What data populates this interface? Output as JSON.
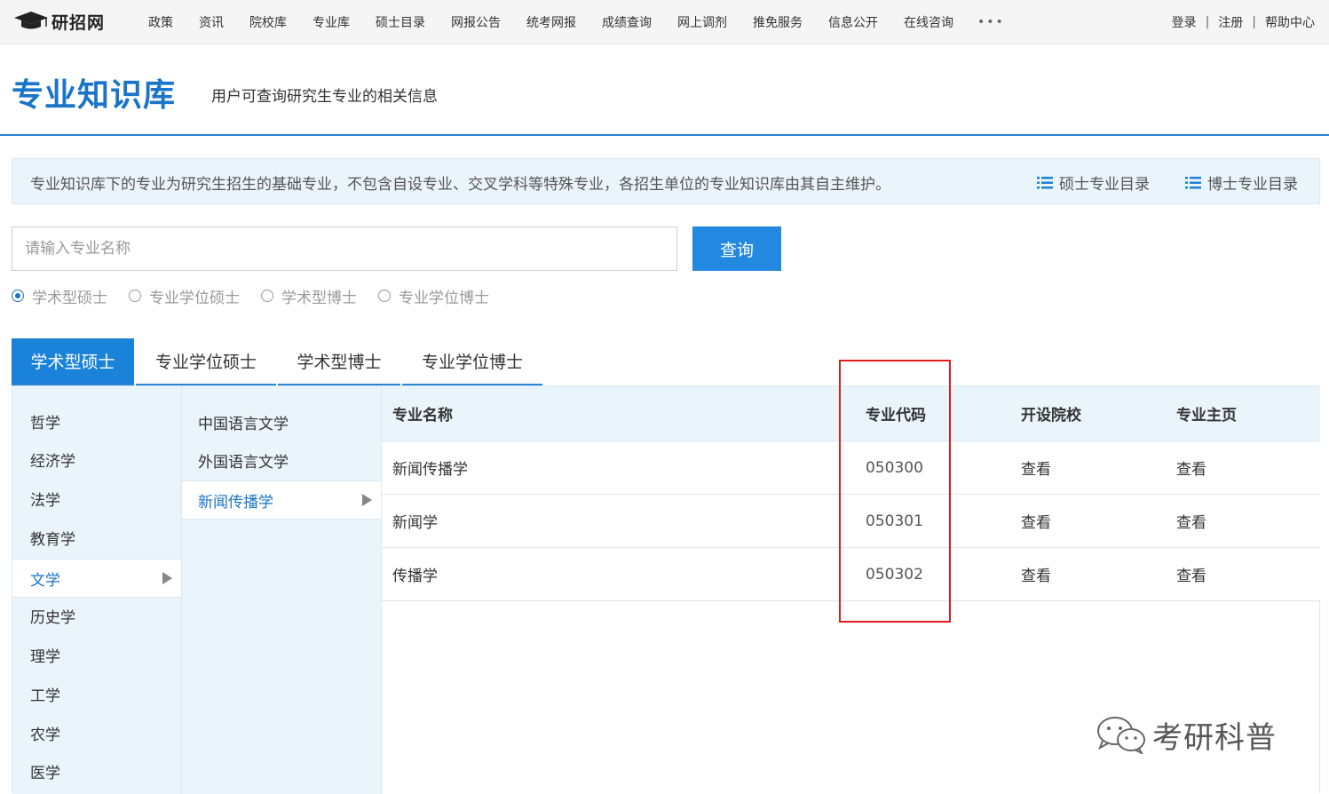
{
  "site": {
    "logo_text": "研招网",
    "nav": [
      "政策",
      "资讯",
      "院校库",
      "专业库",
      "硕士目录",
      "网报公告",
      "统考网报",
      "成绩查询",
      "网上调剂",
      "推免服务",
      "信息公开",
      "在线咨询"
    ],
    "nav_more": "•••",
    "login": "登录",
    "register": "注册",
    "help": "帮助中心",
    "separator": "|"
  },
  "header": {
    "title": "专业知识库",
    "subtitle": "用户可查询研究生专业的相关信息"
  },
  "notice": {
    "text": "专业知识库下的专业为研究生招生的基础专业，不包含自设专业、交叉学科等特殊专业，各招生单位的专业知识库由其自主维护。",
    "link_master": "硕士专业目录",
    "link_doctor": "博士专业目录"
  },
  "search": {
    "placeholder": "请输入专业名称",
    "button": "查询",
    "radios": [
      {
        "label": "学术型硕士",
        "checked": true
      },
      {
        "label": "专业学位硕士",
        "checked": false
      },
      {
        "label": "学术型博士",
        "checked": false
      },
      {
        "label": "专业学位博士",
        "checked": false
      }
    ]
  },
  "tabs": [
    {
      "label": "学术型硕士",
      "active": true
    },
    {
      "label": "专业学位硕士",
      "active": false
    },
    {
      "label": "学术型博士",
      "active": false
    },
    {
      "label": "专业学位博士",
      "active": false
    }
  ],
  "categories": [
    "哲学",
    "经济学",
    "法学",
    "教育学",
    "文学",
    "历史学",
    "理学",
    "工学",
    "农学",
    "医学"
  ],
  "active_category": "文学",
  "subcategories": [
    "中国语言文学",
    "外国语言文学",
    "新闻传播学"
  ],
  "active_subcategory": "新闻传播学",
  "table": {
    "headers": [
      "专业名称",
      "专业代码",
      "开设院校",
      "专业主页"
    ],
    "rows": [
      {
        "name": "新闻传播学",
        "code": "050300",
        "schools": "查看",
        "homepage": "查看"
      },
      {
        "name": "新闻学",
        "code": "050301",
        "schools": "查看",
        "homepage": "查看"
      },
      {
        "name": "传播学",
        "code": "050302",
        "schools": "查看",
        "homepage": "查看"
      }
    ]
  },
  "watermark": {
    "text": "考研科普",
    "icon": "wechat-icon"
  },
  "colors": {
    "brand_blue": "#1a74c9",
    "button_blue": "#2389e0",
    "highlight_red": "#e01b1b",
    "panel_bg": "#eaf4fb"
  }
}
